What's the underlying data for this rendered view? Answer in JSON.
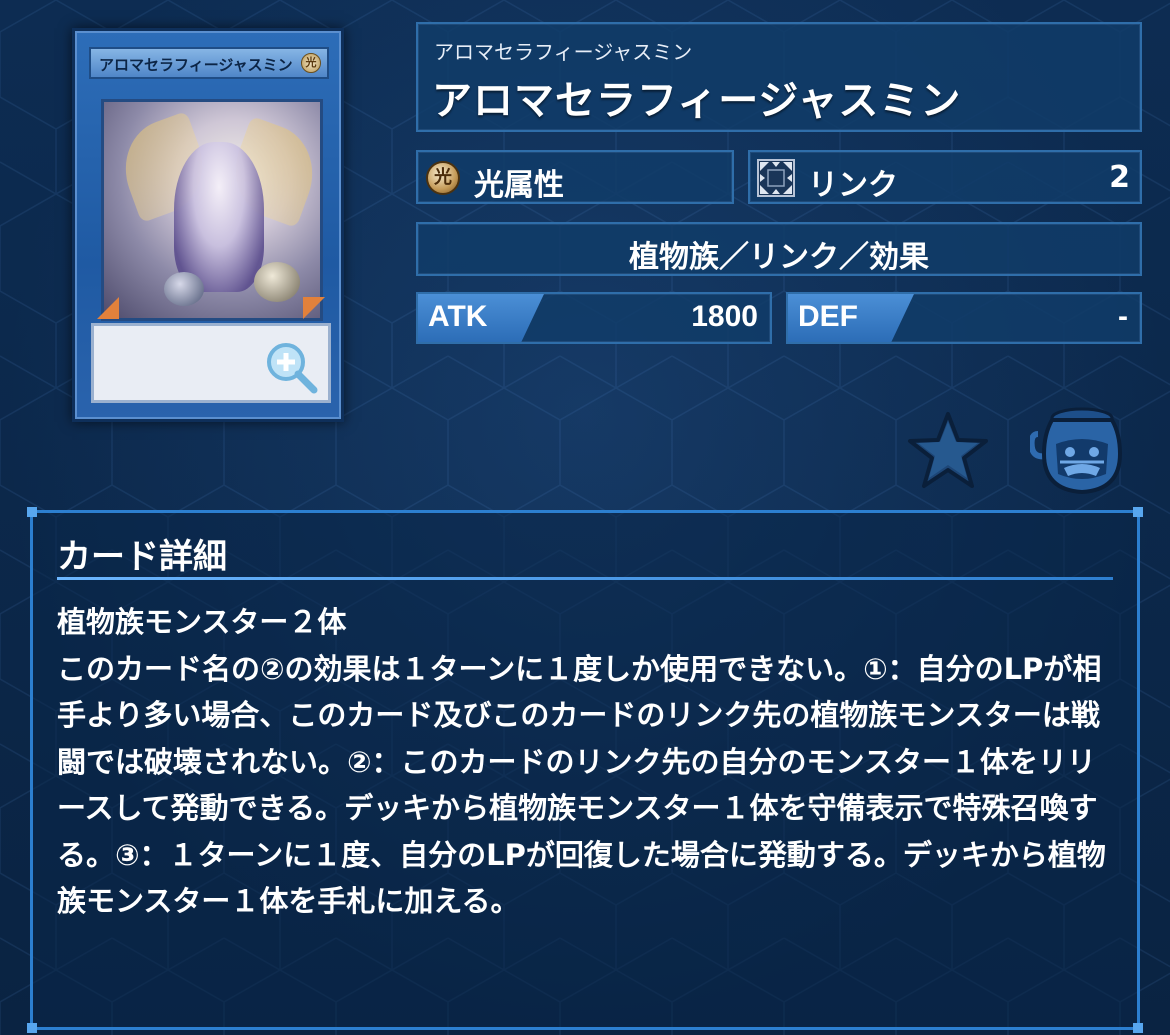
{
  "card": {
    "name_reading": "アロマセラフィージャスミン",
    "name": "アロマセラフィージャスミン",
    "card_art_name": "アロマセラフィージャスミン",
    "card_attr_mini": "光",
    "attribute_icon_char": "光",
    "attribute": "光属性",
    "link_label": "リンク",
    "link_value": "2",
    "type_line": "植物族／リンク／効果",
    "atk_label": "ATK",
    "atk_value": "1800",
    "def_label": "DEF",
    "def_value": "-"
  },
  "details": {
    "title": "カード詳細",
    "text": "植物族モンスター２体\nこのカード名の②の効果は１ターンに１度しか使用できない。①：自分のLPが相手より多い場合、このカード及びこのカードのリンク先の植物族モンスターは戦闘では破壊されない。②：このカードのリンク先の自分のモンスター１体をリリースして発動できる。デッキから植物族モンスター１体を守備表示で特殊召喚する。③：１ターンに１度、自分のLPが回復した場合に発動する。デッキから植物族モンスター１体を手札に加える。"
  },
  "colors": {
    "background": "#0b2748",
    "panel": "#113c69",
    "accent": "#2c7fd0",
    "stat_tab": "#3d80c9"
  },
  "icons": {
    "zoom": "zoom-in-icon",
    "favorite": "star-icon",
    "pot": "pot-of-greed-icon",
    "attribute": "light-attribute-icon",
    "link": "link-arrows-icon"
  }
}
